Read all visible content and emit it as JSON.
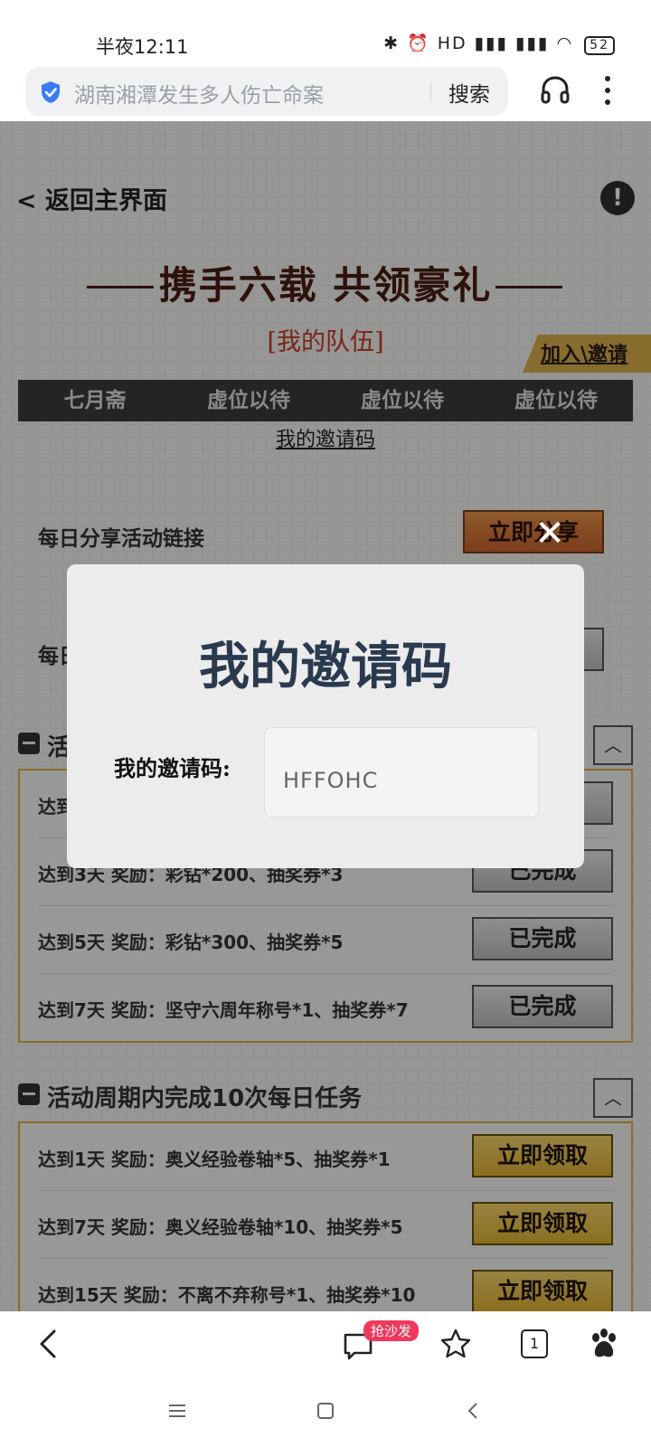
{
  "status_bar": {
    "time": "半夜12:11",
    "icons": "✱ ⏰ HD ▮▮▮ ▮▮▮ ◠",
    "battery": "52"
  },
  "browser": {
    "search_text": "湖南湘潭发生多人伤亡命案",
    "search_button": "搜索"
  },
  "page": {
    "back_label": "< 返回主界面",
    "info_icon": "!",
    "event_title": "携手六载 共领豪礼",
    "team_label": "[我的队伍]",
    "join_invite": "加入\\邀请",
    "team_slots": [
      "七月斋",
      "虚位以待",
      "虚位以待",
      "虚位以待"
    ],
    "my_code_link": "我的邀请码",
    "daily_share_label": "每日分享活动链接",
    "daily_share_button": "立即分享",
    "row2_label": "每日",
    "section1_title": "活",
    "section1_rows": [
      {
        "text": "达到",
        "button": ""
      },
      {
        "text": "达到3天   奖励：彩钻*200、抽奖券*3",
        "button": "已完成"
      },
      {
        "text": "达到5天   奖励：彩钻*300、抽奖券*5",
        "button": "已完成"
      },
      {
        "text": "达到7天   奖励：坚守六周年称号*1、抽奖券*7",
        "button": "已完成"
      }
    ],
    "section2_title": "活动周期内完成10次每日任务",
    "section2_rows": [
      {
        "text": "达到1天   奖励：奥义经验卷轴*5、抽奖券*1",
        "button": "立即领取"
      },
      {
        "text": "达到7天   奖励：奥义经验卷轴*10、抽奖券*5",
        "button": "立即领取"
      },
      {
        "text": "达到15天   奖励：不离不弃称号*1、抽奖券*10",
        "button": "立即领取"
      }
    ],
    "collapse_icon": "︿"
  },
  "modal": {
    "title": "我的邀请码",
    "label": "我的邀请码:",
    "code": "HFFOHC",
    "close": "✕"
  },
  "bottom_nav": {
    "sofa_badge": "抢沙发",
    "tab_count": "1"
  },
  "colors": {
    "accent_gold": "#d8b04a",
    "title_brown": "#4a1e12",
    "team_red": "#c33a24",
    "modal_title": "#2a3a4e"
  }
}
